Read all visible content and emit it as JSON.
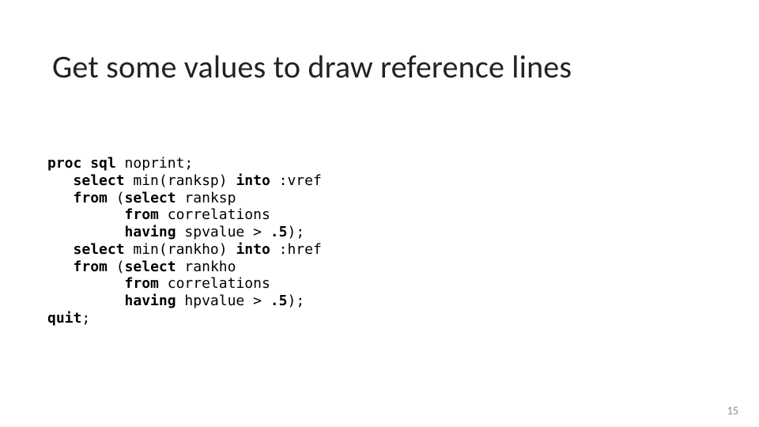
{
  "slide": {
    "title": "Get some values to draw reference lines",
    "page_number": "15",
    "code": {
      "l01_proc": "proc",
      "l01_sql": "sql",
      "l01_rest": " noprint;",
      "l02_pad": "   ",
      "l02_select": "select",
      "l02_mid": " min(ranksp) ",
      "l02_into": "into",
      "l02_rest": " :vref",
      "l03_pad": "   ",
      "l03_from": "from",
      "l03_mid": " (",
      "l03_select": "select",
      "l03_rest": " ranksp",
      "l04_pad": "         ",
      "l04_from": "from",
      "l04_rest": " correlations",
      "l05_pad": "         ",
      "l05_having": "having",
      "l05_mid": " spvalue > ",
      "l05_dot": ".",
      "l05_five": "5",
      "l05_rest": ");",
      "l06_pad": "   ",
      "l06_select": "select",
      "l06_mid": " min(rankho) ",
      "l06_into": "into",
      "l06_rest": " :href",
      "l07_pad": "   ",
      "l07_from": "from",
      "l07_mid": " (",
      "l07_select": "select",
      "l07_rest": " rankho",
      "l08_pad": "         ",
      "l08_from": "from",
      "l08_rest": " correlations",
      "l09_pad": "         ",
      "l09_having": "having",
      "l09_mid": " hpvalue > ",
      "l09_dot": ".",
      "l09_five": "5",
      "l09_rest": ");",
      "l10_quit": "quit",
      "l10_rest": ";"
    }
  }
}
